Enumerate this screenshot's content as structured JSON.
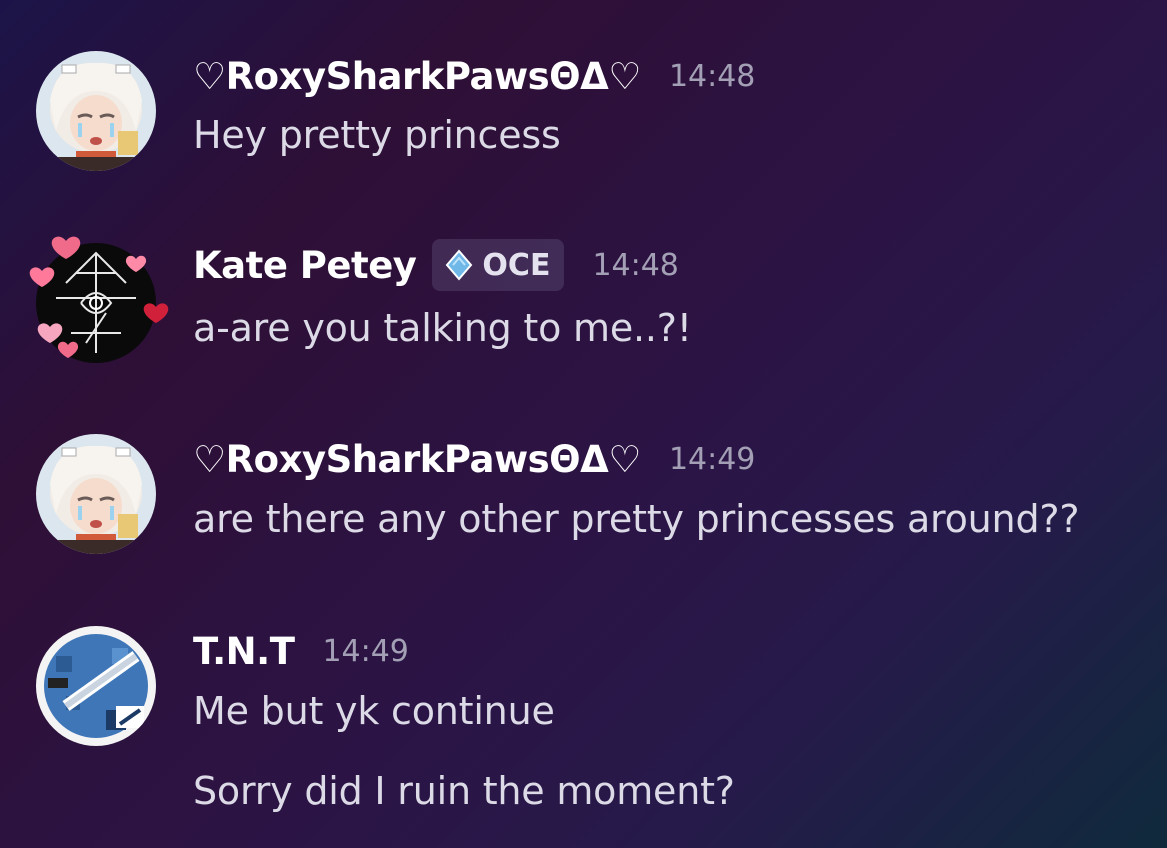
{
  "messages": [
    {
      "author": "♡RoxySharkPawsΘΔ♡",
      "time": "14:48",
      "lines": [
        "Hey pretty princess"
      ]
    },
    {
      "author": "Kate Petey",
      "badge": {
        "icon": "water-drop-icon",
        "label": "OCE"
      },
      "time": "14:48",
      "lines": [
        "a-are you talking to me..?!"
      ]
    },
    {
      "author": "♡RoxySharkPawsΘΔ♡",
      "time": "14:49",
      "lines": [
        "are there any other pretty princesses around??"
      ]
    },
    {
      "author": "T.N.T",
      "time": "14:49",
      "lines": [
        "Me but yk continue",
        "Sorry did I ruin the moment?"
      ]
    }
  ],
  "colors": {
    "username": "#ffffff",
    "message_text": "#dcdae6",
    "timestamp": "#a3a0b5",
    "badge_bg": "#3e3450"
  }
}
